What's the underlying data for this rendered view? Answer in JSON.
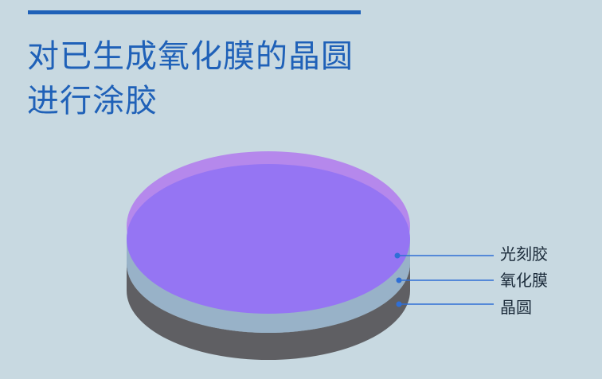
{
  "title": {
    "line1": "对已生成氧化膜的晶圆",
    "line2": "进行涂胶"
  },
  "layers": [
    {
      "label": "光刻胶"
    },
    {
      "label": "氧化膜"
    },
    {
      "label": "晶圆"
    }
  ],
  "colors": {
    "background": "#c8d9e1",
    "title": "#1f61b8",
    "photoresist": "#9575f3",
    "photoresist_rim": "#b588ec",
    "oxide": "#98b2c8",
    "wafer": "#5f5f63",
    "leader": "#2f6fd6"
  }
}
